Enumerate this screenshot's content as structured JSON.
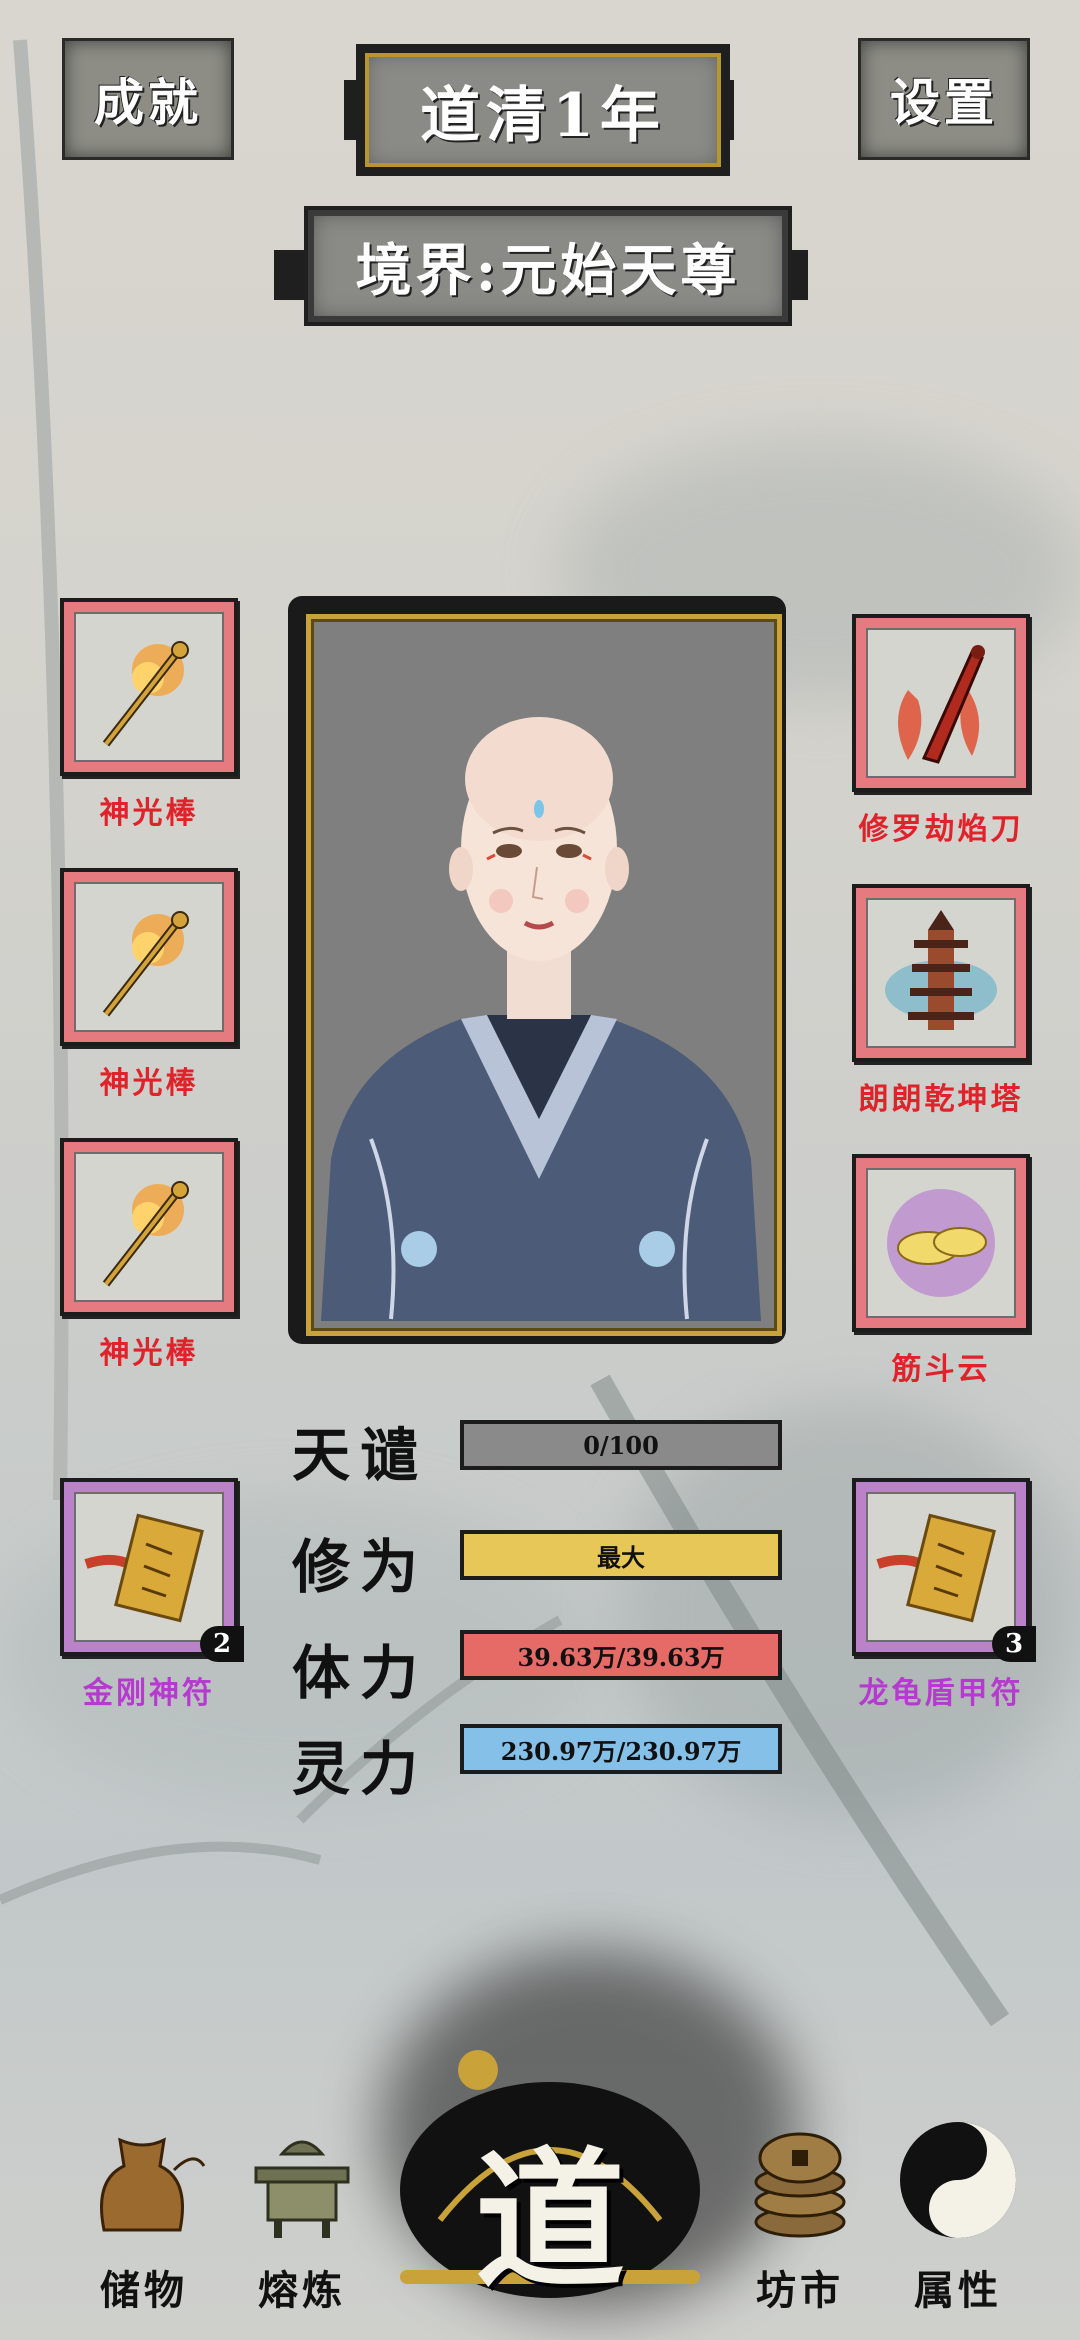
{
  "header": {
    "achievement_label": "成就",
    "settings_label": "设置",
    "year": "道清1年",
    "realm": "境界:元始天尊"
  },
  "equipment_left": [
    {
      "name": "神光棒",
      "rarity_color": "#e0222a"
    },
    {
      "name": "神光棒",
      "rarity_color": "#e0222a"
    },
    {
      "name": "神光棒",
      "rarity_color": "#e0222a"
    }
  ],
  "equipment_right": [
    {
      "name": "修罗劫焰刀",
      "rarity_color": "#e0222a"
    },
    {
      "name": "朗朗乾坤塔",
      "rarity_color": "#e0222a"
    },
    {
      "name": "筋斗云",
      "rarity_color": "#e0222a"
    }
  ],
  "talismans": [
    {
      "name": "金刚神符",
      "count": "2",
      "rarity_color": "#b73ad0"
    },
    {
      "name": "龙龟盾甲符",
      "count": "3",
      "rarity_color": "#b73ad0"
    }
  ],
  "stats": [
    {
      "label": "天谴",
      "value": "0/100",
      "color": "#8a8a8a"
    },
    {
      "label": "修为",
      "value": "最大",
      "color": "#e6c757"
    },
    {
      "label": "体力",
      "value": "39.63万/39.63万",
      "color": "#e66a66"
    },
    {
      "label": "灵力",
      "value": "230.97万/230.97万",
      "color": "#85c0e8"
    }
  ],
  "nav": {
    "storage": "储物",
    "smelt": "熔炼",
    "center": "道",
    "market": "坊市",
    "attributes": "属性"
  }
}
